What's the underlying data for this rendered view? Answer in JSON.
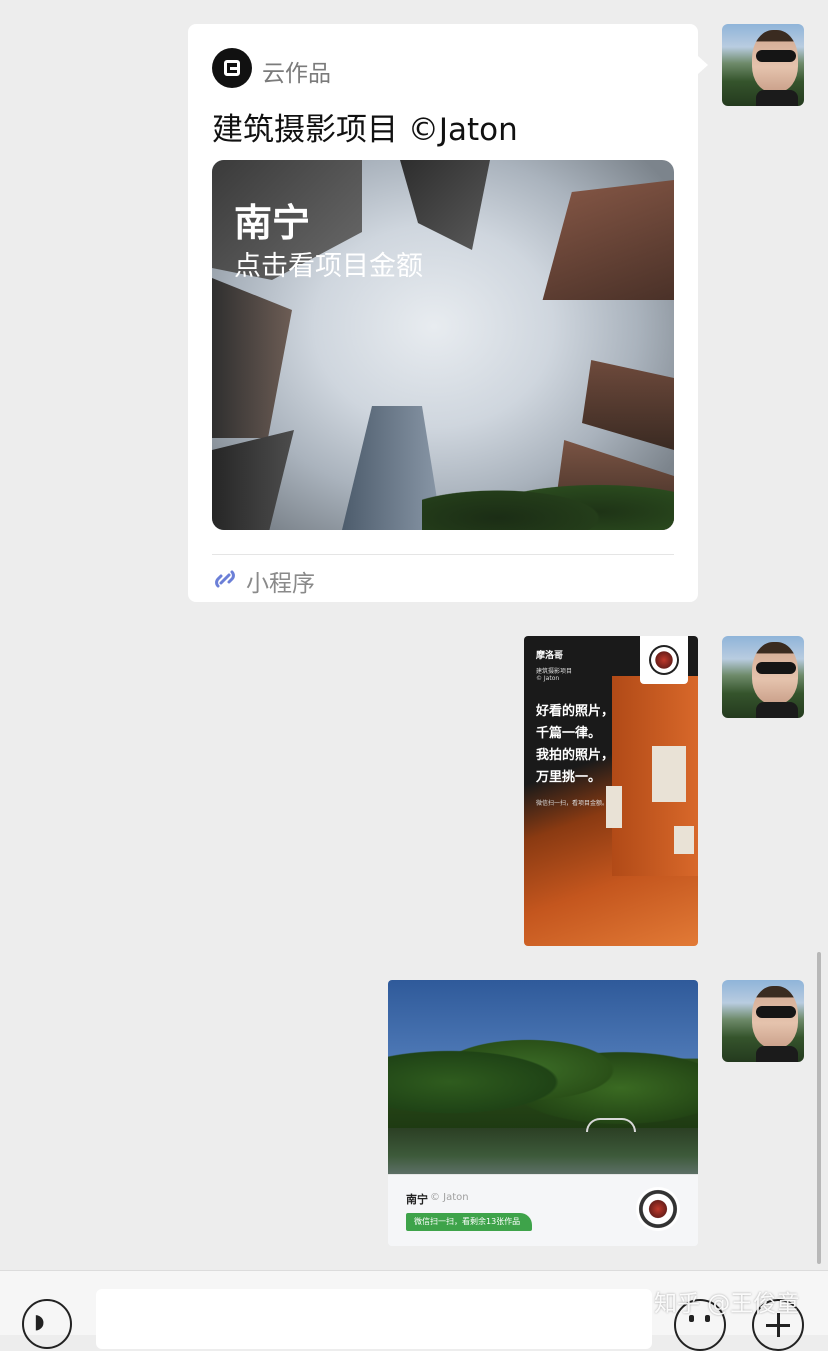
{
  "messages": {
    "mini_program": {
      "app_name": "云作品",
      "title": "建筑摄影项目 ©Jaton",
      "image_city": "南宁",
      "image_subtitle": "点击看项目金额",
      "footer_label": "小程序"
    },
    "poster": {
      "author": "摩洛哥",
      "project": "建筑摄影项目",
      "credit": "© Jaton",
      "lines": [
        "好看的照片，",
        "千篇一律。",
        "我拍的照片，",
        "万里挑一。"
      ],
      "footer": "微信扫一扫，看项目金额。"
    },
    "park_card": {
      "city": "南宁",
      "author": "© Jaton",
      "badge": "微信扫一扫，看剩余13张作品"
    }
  },
  "watermark": "知乎 @王俊童",
  "icons": {
    "voice": "voice-icon",
    "emoji": "emoji-icon",
    "plus": "plus-icon",
    "link": "mini-program-link-icon"
  },
  "colors": {
    "background": "#ededed",
    "card": "#ffffff",
    "badge_green": "#3ea34a",
    "link_icon": "#6b7fd7"
  }
}
